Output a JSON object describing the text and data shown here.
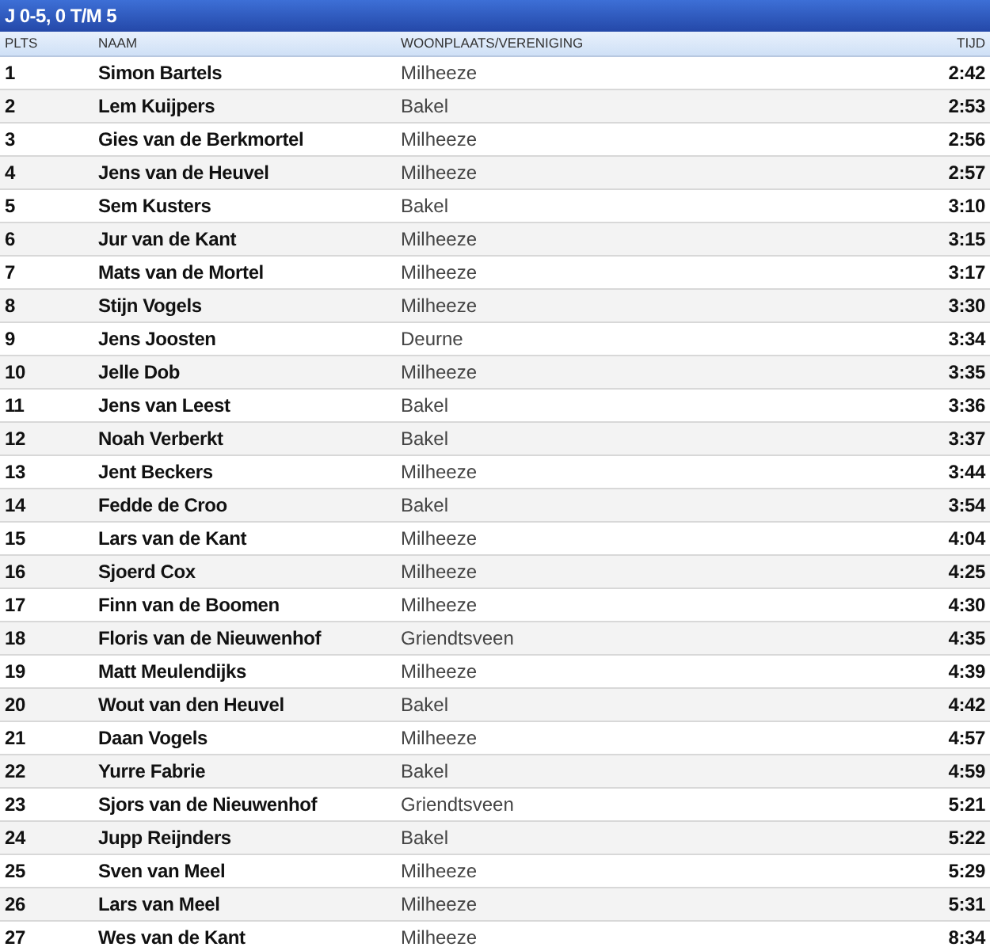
{
  "title": "J 0-5, 0 T/M 5",
  "columns": [
    "PLTS",
    "NAAM",
    "WOONPLAATS/VERENIGING",
    "TIJD"
  ],
  "rows": [
    {
      "place": "1",
      "name": "Simon Bartels",
      "club": "Milheeze",
      "time": "2:42"
    },
    {
      "place": "2",
      "name": "Lem Kuijpers",
      "club": "Bakel",
      "time": "2:53"
    },
    {
      "place": "3",
      "name": "Gies van de Berkmortel",
      "club": "Milheeze",
      "time": "2:56"
    },
    {
      "place": "4",
      "name": "Jens van de Heuvel",
      "club": "Milheeze",
      "time": "2:57"
    },
    {
      "place": "5",
      "name": "Sem Kusters",
      "club": "Bakel",
      "time": "3:10"
    },
    {
      "place": "6",
      "name": "Jur van de Kant",
      "club": "Milheeze",
      "time": "3:15"
    },
    {
      "place": "7",
      "name": "Mats van de Mortel",
      "club": "Milheeze",
      "time": "3:17"
    },
    {
      "place": "8",
      "name": "Stijn Vogels",
      "club": "Milheeze",
      "time": "3:30"
    },
    {
      "place": "9",
      "name": "Jens Joosten",
      "club": "Deurne",
      "time": "3:34"
    },
    {
      "place": "10",
      "name": "Jelle Dob",
      "club": "Milheeze",
      "time": "3:35"
    },
    {
      "place": "11",
      "name": "Jens van Leest",
      "club": "Bakel",
      "time": "3:36"
    },
    {
      "place": "12",
      "name": "Noah Verberkt",
      "club": "Bakel",
      "time": "3:37"
    },
    {
      "place": "13",
      "name": "Jent Beckers",
      "club": "Milheeze",
      "time": "3:44"
    },
    {
      "place": "14",
      "name": "Fedde de Croo",
      "club": "Bakel",
      "time": "3:54"
    },
    {
      "place": "15",
      "name": "Lars van de Kant",
      "club": "Milheeze",
      "time": "4:04"
    },
    {
      "place": "16",
      "name": "Sjoerd Cox",
      "club": "Milheeze",
      "time": "4:25"
    },
    {
      "place": "17",
      "name": "Finn van de Boomen",
      "club": "Milheeze",
      "time": "4:30"
    },
    {
      "place": "18",
      "name": "Floris van de Nieuwenhof",
      "club": "Griendtsveen",
      "time": "4:35"
    },
    {
      "place": "19",
      "name": "Matt Meulendijks",
      "club": "Milheeze",
      "time": "4:39"
    },
    {
      "place": "20",
      "name": "Wout van den Heuvel",
      "club": "Bakel",
      "time": "4:42"
    },
    {
      "place": "21",
      "name": "Daan Vogels",
      "club": "Milheeze",
      "time": "4:57"
    },
    {
      "place": "22",
      "name": "Yurre Fabrie",
      "club": "Bakel",
      "time": "4:59"
    },
    {
      "place": "23",
      "name": "Sjors van de Nieuwenhof",
      "club": "Griendtsveen",
      "time": "5:21"
    },
    {
      "place": "24",
      "name": "Jupp Reijnders",
      "club": "Bakel",
      "time": "5:22"
    },
    {
      "place": "25",
      "name": "Sven van Meel",
      "club": "Milheeze",
      "time": "5:29"
    },
    {
      "place": "26",
      "name": "Lars van Meel",
      "club": "Milheeze",
      "time": "5:31"
    },
    {
      "place": "27",
      "name": "Wes van de Kant",
      "club": "Milheeze",
      "time": "8:34"
    }
  ]
}
